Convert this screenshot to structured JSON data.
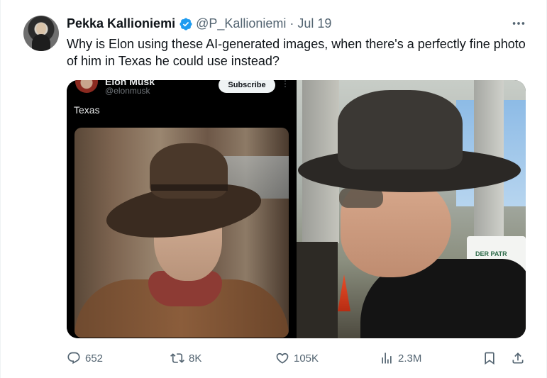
{
  "tweet": {
    "author": {
      "display_name": "Pekka Kallioniemi",
      "handle": "@P_Kallioniemi",
      "separator": "·",
      "date": "Jul 19"
    },
    "more_icon": "more-dots-icon",
    "text": "Why is Elon using these AI-generated images, when there's a perfectly fine photo of him in Texas he could use instead?",
    "media": {
      "embedded_post": {
        "name": "Elon Musk",
        "handle": "@elonmusk",
        "subscribe_label": "Subscribe",
        "text": "Texas"
      },
      "right_photo_sign": "DER PATR"
    },
    "actions": {
      "reply_count": "652",
      "repost_count": "8K",
      "like_count": "105K",
      "view_count": "2.3M"
    }
  },
  "colors": {
    "text_primary": "#0f1419",
    "text_secondary": "#536471",
    "verified_blue": "#1d9bf0"
  }
}
